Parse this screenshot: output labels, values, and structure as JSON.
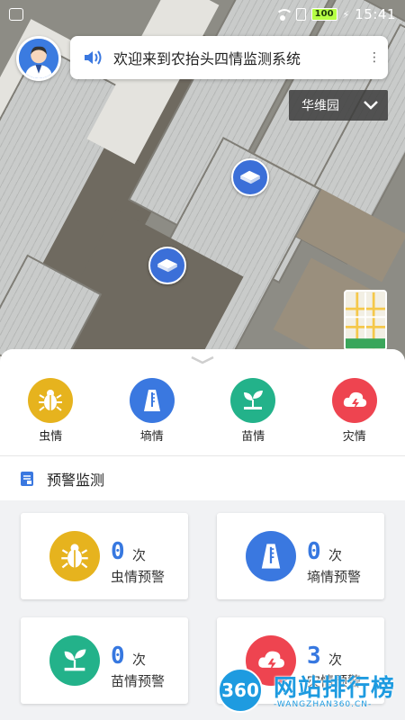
{
  "status_bar": {
    "battery": "100",
    "time": "15:41"
  },
  "header": {
    "welcome_text": "欢迎来到农抬头四情监测系统",
    "region": "华维园"
  },
  "categories": [
    {
      "label": "虫情",
      "icon": "bug-icon",
      "color": "#e6b31e"
    },
    {
      "label": "墒情",
      "icon": "soil-gauge-icon",
      "color": "#3a78e0"
    },
    {
      "label": "苗情",
      "icon": "sprout-icon",
      "color": "#23b28a"
    },
    {
      "label": "灾情",
      "icon": "storm-cloud-icon",
      "color": "#ee4450"
    }
  ],
  "section": {
    "title": "预警监测"
  },
  "warning_cards": [
    {
      "count": "0",
      "unit": "次",
      "name": "虫情预警",
      "icon": "bug-icon",
      "color": "#e6b31e"
    },
    {
      "count": "0",
      "unit": "次",
      "name": "墒情预警",
      "icon": "soil-gauge-icon",
      "color": "#3a78e0"
    },
    {
      "count": "0",
      "unit": "次",
      "name": "苗情预警",
      "icon": "sprout-icon",
      "color": "#23b28a"
    },
    {
      "count": "3",
      "unit": "次",
      "name": "灾情预警",
      "icon": "storm-cloud-icon",
      "color": "#ee4450"
    }
  ],
  "watermark": {
    "badge": "360",
    "name": "网站排行榜",
    "url": "-WANGZHAN360.CN-"
  }
}
